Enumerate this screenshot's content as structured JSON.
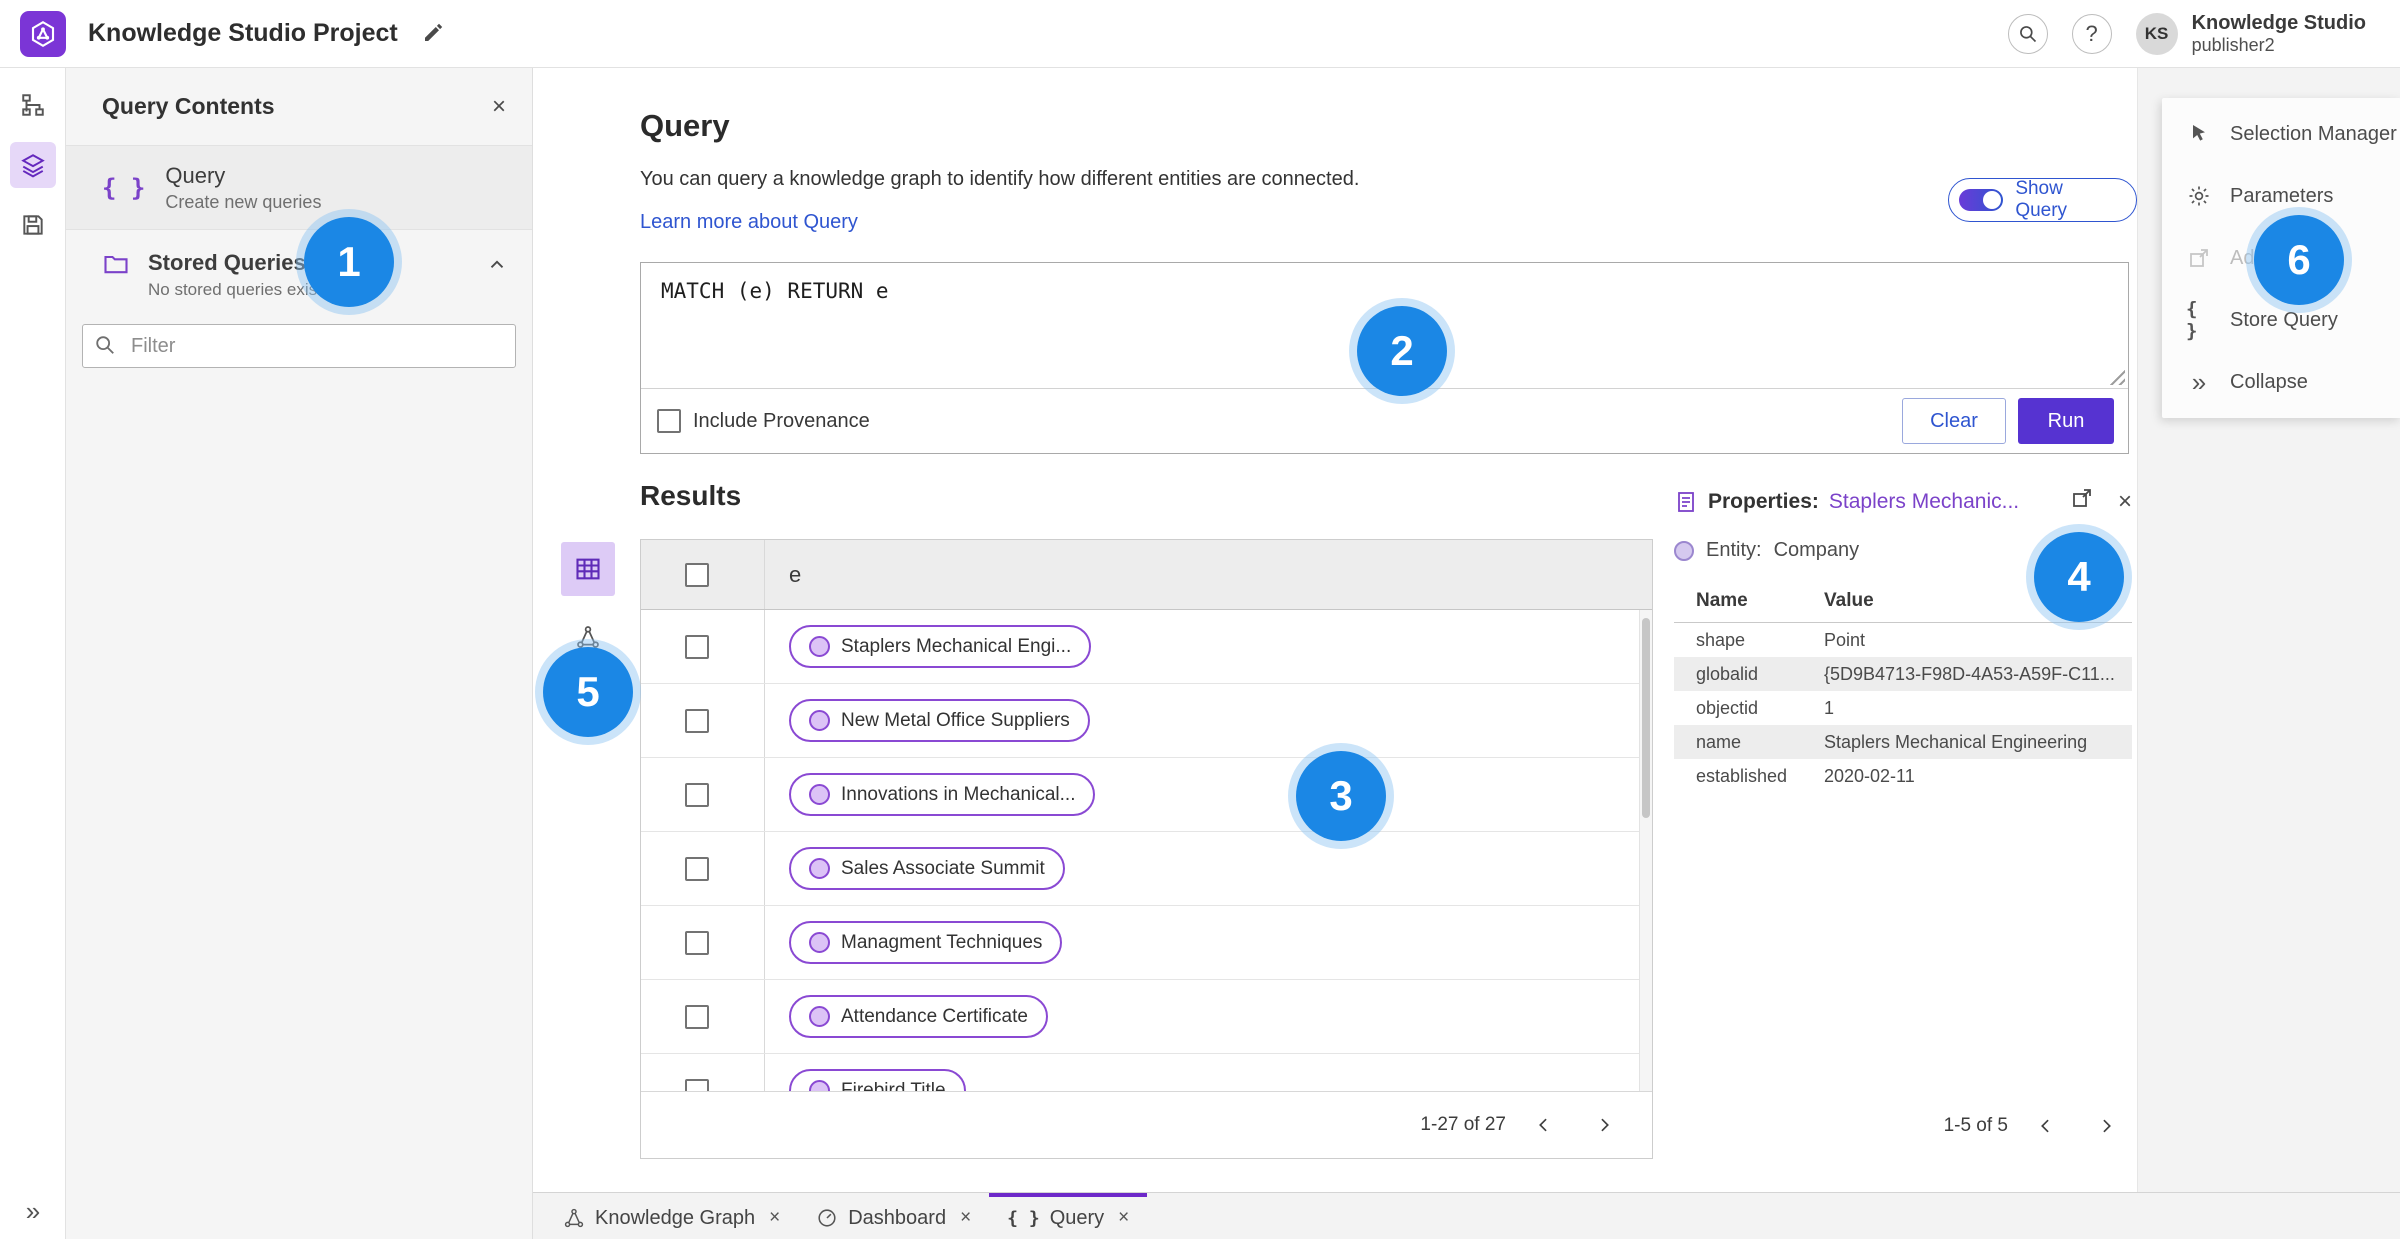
{
  "colors": {
    "accent_purple": "#7b42c9",
    "accent_blue": "#2f55d0",
    "run_button": "#5633d1",
    "badge_blue": "#1b87e5"
  },
  "icons": {
    "braces": "{ }",
    "close": "×",
    "help": "?",
    "collapse_rail": "»"
  },
  "topbar": {
    "title": "Knowledge Studio Project",
    "user_initials": "KS",
    "user_name": "Knowledge Studio",
    "user_role": "publisher2"
  },
  "left_panel": {
    "title": "Query Contents",
    "query_item_title": "Query",
    "query_item_subtitle": "Create new queries",
    "stored_title": "Stored Queries",
    "stored_subtitle": "No stored queries exist",
    "filter_placeholder": "Filter"
  },
  "query": {
    "title": "Query",
    "description": "You can query a knowledge graph to identify how different entities are connected.",
    "learn_link": "Learn more about Query",
    "show_query": "Show Query",
    "code": "MATCH (e) RETURN e",
    "include_provenance": "Include Provenance",
    "clear": "Clear",
    "run": "Run"
  },
  "results": {
    "title": "Results",
    "column": "e",
    "rows": [
      "Staplers Mechanical Engi...",
      "New Metal Office Suppliers",
      "Innovations in Mechanical...",
      "Sales Associate Summit",
      "Managment Techniques",
      "Attendance Certificate",
      "Firebird Title"
    ],
    "pagination": "1-27 of 27"
  },
  "properties": {
    "label": "Properties:",
    "entity_link": "Staplers Mechanic...",
    "entity_label": "Entity:",
    "entity_type": "Company",
    "col_name": "Name",
    "col_value": "Value",
    "rows": [
      {
        "name": "shape",
        "value": "Point"
      },
      {
        "name": "globalid",
        "value": "{5D9B4713-F98D-4A53-A59F-C11..."
      },
      {
        "name": "objectid",
        "value": "1"
      },
      {
        "name": "name",
        "value": "Staplers Mechanical Engineering"
      },
      {
        "name": "established",
        "value": "2020-02-11"
      }
    ],
    "pagination": "1-5 of 5"
  },
  "right_menu": {
    "selection_manager": "Selection Manager",
    "parameters": "Parameters",
    "add": "Add",
    "store_query": "Store Query",
    "collapse": "Collapse"
  },
  "tabs": {
    "knowledge_graph": "Knowledge Graph",
    "dashboard": "Dashboard",
    "query": "Query"
  },
  "badges": {
    "b1": "1",
    "b2": "2",
    "b3": "3",
    "b4": "4",
    "b5": "5",
    "b6": "6"
  }
}
